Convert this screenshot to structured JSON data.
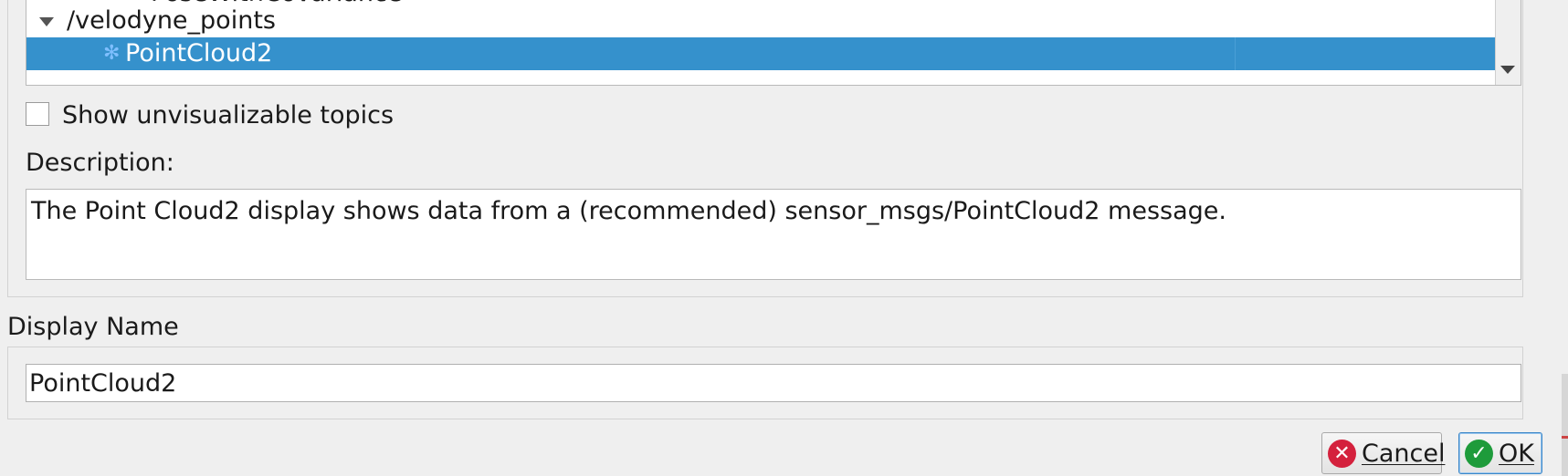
{
  "topic_tree": {
    "items": [
      {
        "label": "PoseWithCovariance"
      },
      {
        "label": "/velodyne_points"
      },
      {
        "label": "PointCloud2"
      }
    ]
  },
  "options": {
    "show_unvisualizable_label": "Show unvisualizable topics",
    "show_unvisualizable_checked": false
  },
  "description": {
    "label": "Description:",
    "text": "The Point Cloud2 display shows data from a (recommended) sensor_msgs/PointCloud2 message."
  },
  "display_name": {
    "label": "Display Name",
    "value": "PointCloud2"
  },
  "buttons": {
    "cancel_label": "Cancel",
    "ok_label": "OK",
    "cancel_icon": "cancel-icon",
    "ok_icon": "ok-check-icon"
  },
  "colors": {
    "selection": "#3591cc",
    "cancel_icon": "#d4213d",
    "ok_icon": "#1e9b3b"
  }
}
